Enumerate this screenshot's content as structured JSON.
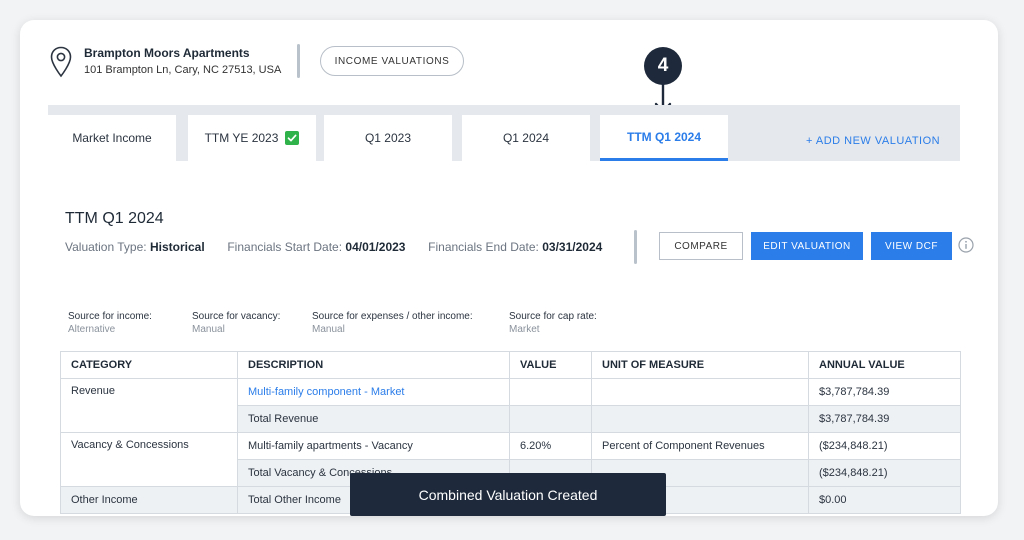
{
  "property": {
    "name": "Brampton Moors Apartments",
    "address": "101 Brampton Ln, Cary, NC 27513, USA"
  },
  "header": {
    "income_valuations_label": "INCOME VALUATIONS"
  },
  "step_marker": {
    "number": "4"
  },
  "tabs": [
    {
      "label": "Market Income"
    },
    {
      "label": "TTM YE 2023",
      "checked": true
    },
    {
      "label": "Q1 2023"
    },
    {
      "label": "Q1 2024"
    },
    {
      "label": "TTM Q1 2024",
      "active": true
    }
  ],
  "add_valuation_label": "+ ADD NEW VALUATION",
  "valuation": {
    "title": "TTM Q1 2024",
    "type_label": "Valuation Type:",
    "type_value": "Historical",
    "start_label": "Financials Start Date:",
    "start_value": "04/01/2023",
    "end_label": "Financials End Date:",
    "end_value": "03/31/2024"
  },
  "actions": {
    "compare": "COMPARE",
    "edit": "EDIT VALUATION",
    "view_dcf": "VIEW DCF"
  },
  "sources": [
    {
      "label": "Source for income:",
      "value": "Alternative"
    },
    {
      "label": "Source for vacancy:",
      "value": "Manual"
    },
    {
      "label": "Source for expenses / other income:",
      "value": "Manual"
    },
    {
      "label": "Source for cap rate:",
      "value": "Market"
    }
  ],
  "table": {
    "headers": [
      "CATEGORY",
      "DESCRIPTION",
      "VALUE",
      "UNIT OF MEASURE",
      "ANNUAL VALUE"
    ],
    "rows": {
      "revenue_category": "Revenue",
      "revenue_desc": "Multi-family component - Market",
      "revenue_annual": "$3,787,784.39",
      "total_revenue_desc": "Total Revenue",
      "total_revenue_annual": "$3,787,784.39",
      "vacancy_category": "Vacancy & Concessions",
      "vacancy_desc": "Multi-family apartments - Vacancy",
      "vacancy_value": "6.20%",
      "vacancy_unit": "Percent of Component Revenues",
      "vacancy_annual": "($234,848.21)",
      "total_vacancy_desc": "Total Vacancy & Concessions",
      "total_vacancy_annual": "($234,848.21)",
      "other_category": "Other Income",
      "other_desc": "Total Other Income",
      "other_annual": "$0.00"
    }
  },
  "toast": {
    "message": "Combined Valuation Created"
  },
  "colors": {
    "accent": "#2b7de9",
    "dark": "#1e2a3b",
    "success": "#2fb24a"
  }
}
